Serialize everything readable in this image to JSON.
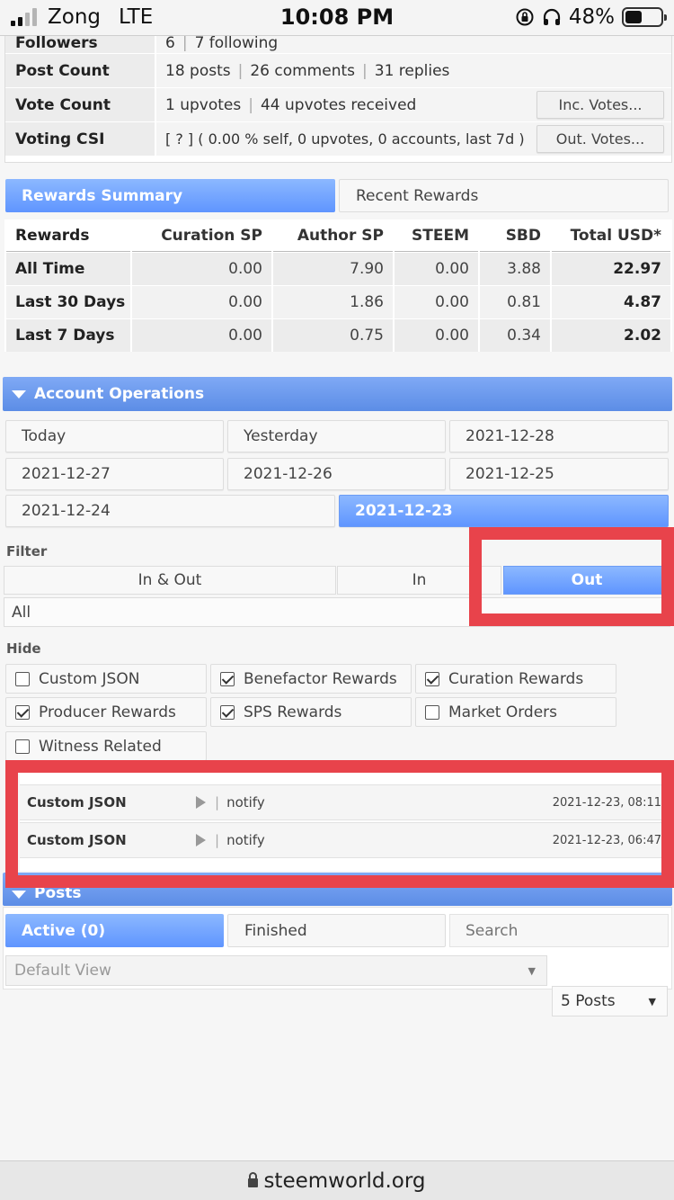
{
  "status_bar": {
    "carrier": "Zong",
    "network": "LTE",
    "time": "10:08 PM",
    "battery": "48%",
    "battery_level": 0.48
  },
  "account_info": {
    "followers_label": "Followers",
    "followers_count": "6",
    "following": "7 following",
    "post_count_label": "Post Count",
    "posts": "18 posts",
    "comments": "26 comments",
    "replies": "31 replies",
    "vote_count_label": "Vote Count",
    "upvotes": "1 upvotes",
    "upvotes_received": "44 upvotes received",
    "inc_votes_button": "Inc. Votes...",
    "voting_csi_label": "Voting CSI",
    "voting_csi_value": "[ ? ] ( 0.00 % self, 0 upvotes, 0 accounts, last 7d )",
    "out_votes_button": "Out. Votes..."
  },
  "reward_tabs": [
    "Rewards Summary",
    "Recent Rewards"
  ],
  "rewards_table": {
    "headers": [
      "Rewards",
      "Curation SP",
      "Author SP",
      "STEEM",
      "SBD",
      "Total USD*"
    ],
    "rows": [
      [
        "All Time",
        "0.00",
        "7.90",
        "0.00",
        "3.88",
        "22.97"
      ],
      [
        "Last 30 Days",
        "0.00",
        "1.86",
        "0.00",
        "0.81",
        "4.87"
      ],
      [
        "Last 7 Days",
        "0.00",
        "0.75",
        "0.00",
        "0.34",
        "2.02"
      ]
    ]
  },
  "account_operations": {
    "title": "Account Operations",
    "dates": [
      "Today",
      "Yesterday",
      "2021-12-28",
      "2021-12-27",
      "2021-12-26",
      "2021-12-25",
      "2021-12-24",
      "2021-12-23"
    ],
    "filter_label": "Filter",
    "filter_options": [
      "In & Out",
      "In",
      "Out"
    ],
    "filter_type": "All",
    "hide_label": "Hide",
    "hide_options": [
      {
        "label": "Custom JSON",
        "checked": false
      },
      {
        "label": "Benefactor Rewards",
        "checked": true
      },
      {
        "label": "Curation Rewards",
        "checked": true
      },
      {
        "label": "Producer Rewards",
        "checked": true
      },
      {
        "label": "SPS Rewards",
        "checked": true
      },
      {
        "label": "Market Orders",
        "checked": false
      },
      {
        "label": "Witness Related",
        "checked": false
      }
    ],
    "operations": [
      {
        "type": "Custom JSON",
        "detail": "notify",
        "date": "2021-12-23, 08:11"
      },
      {
        "type": "Custom JSON",
        "detail": "notify",
        "date": "2021-12-23, 06:47"
      }
    ]
  },
  "posts": {
    "title": "Posts",
    "tabs": [
      "Active (0)",
      "Finished"
    ],
    "search_placeholder": "Search",
    "view_select": "Default View",
    "count_select": "5 Posts"
  },
  "url_bar": {
    "domain": "steemworld.org"
  },
  "colors": {
    "accent_blue": "#5f95ff",
    "highlight_red": "#e8434b"
  }
}
